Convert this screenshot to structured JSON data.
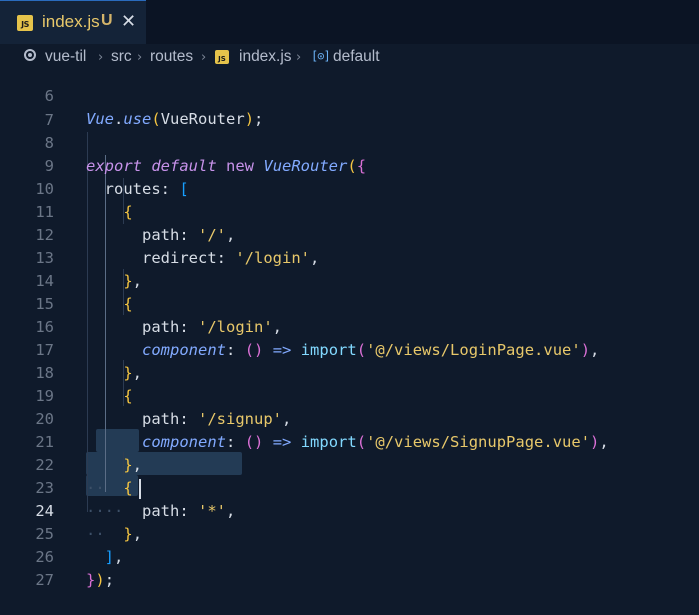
{
  "tab": {
    "icon_label": "JS",
    "title": "index.js",
    "status": "U",
    "close": "✕"
  },
  "breadcrumb": {
    "items": [
      "vue-til",
      "src",
      "routes",
      "index.js",
      "default"
    ],
    "separator": "›",
    "symbol_icon": "[⊙]"
  },
  "editor": {
    "active_line": 24,
    "lines": [
      {
        "n": "6"
      },
      {
        "n": "7"
      },
      {
        "n": "8"
      },
      {
        "n": "9"
      },
      {
        "n": "10"
      },
      {
        "n": "11"
      },
      {
        "n": "12"
      },
      {
        "n": "13"
      },
      {
        "n": "14"
      },
      {
        "n": "15"
      },
      {
        "n": "16"
      },
      {
        "n": "17"
      },
      {
        "n": "18"
      },
      {
        "n": "19"
      },
      {
        "n": "20"
      },
      {
        "n": "21"
      },
      {
        "n": "22"
      },
      {
        "n": "23"
      },
      {
        "n": "24"
      },
      {
        "n": "25"
      },
      {
        "n": "26"
      },
      {
        "n": "27"
      }
    ],
    "code": {
      "l6": [
        "Vue",
        ".",
        "use",
        "(",
        "VueRouter",
        ")",
        ";"
      ],
      "l8": [
        "export",
        "default",
        "new",
        "VueRouter",
        "(",
        "{"
      ],
      "l9": [
        "routes",
        ":",
        "["
      ],
      "l10": [
        "{"
      ],
      "l11": [
        "path",
        ":",
        "'/'",
        ","
      ],
      "l12": [
        "redirect",
        ":",
        "'/login'",
        ","
      ],
      "l13": [
        "}",
        ","
      ],
      "l14": [
        "{"
      ],
      "l15": [
        "path",
        ":",
        "'/login'",
        ","
      ],
      "l16": [
        "component",
        ":",
        "()",
        "=>",
        "import",
        "(",
        "'@/views/LoginPage.vue'",
        ")",
        ","
      ],
      "l17": [
        "}",
        ","
      ],
      "l18": [
        "{"
      ],
      "l19": [
        "path",
        ":",
        "'/signup'",
        ","
      ],
      "l20": [
        "component",
        ":",
        "()",
        "=>",
        "import",
        "(",
        "'@/views/SignupPage.vue'",
        ")",
        ","
      ],
      "l21": [
        "}",
        ","
      ],
      "l22": [
        "{"
      ],
      "l23": [
        "path",
        ":",
        "'*'",
        ","
      ],
      "l24": [
        "}",
        ","
      ],
      "l25": [
        "]",
        ","
      ],
      "l26": [
        "}",
        ")",
        ";"
      ]
    }
  },
  "colors": {
    "background": "#0f1a2b",
    "tab_active": "#142338",
    "selection": "#233b55",
    "keyword": "#c792ea",
    "string": "#e8c86a",
    "class": "#82aaff"
  }
}
